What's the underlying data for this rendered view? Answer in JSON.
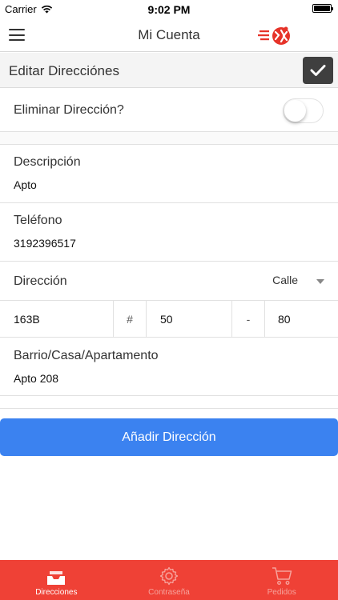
{
  "status_bar": {
    "carrier": "Carrier",
    "time": "9:02 PM"
  },
  "nav": {
    "title": "Mi Cuenta",
    "menu_icon": "hamburger-menu-icon",
    "logo": "brand-logo"
  },
  "section": {
    "title": "Editar Direcciónes",
    "confirm_icon": "checkmark-icon"
  },
  "form": {
    "delete_label": "Eliminar Dirección?",
    "delete_toggle_on": false,
    "description_label": "Descripción",
    "description_value": "Apto",
    "phone_label": "Teléfono",
    "phone_value": "3192396517",
    "address_label": "Dirección",
    "street_type": "Calle",
    "address_parts": {
      "number1": "163B",
      "hash": "#",
      "number2": "50",
      "dash": "-",
      "number3": "80"
    },
    "neighborhood_label": "Barrio/Casa/Apartamento",
    "neighborhood_value": "Apto 208"
  },
  "actions": {
    "add_address": "Añadir Dirección"
  },
  "tabs": [
    {
      "label": "Direcciones",
      "icon": "inbox-icon",
      "active": true
    },
    {
      "label": "Contraseña",
      "icon": "gear-icon",
      "active": false
    },
    {
      "label": "Pedidos",
      "icon": "cart-icon",
      "active": false
    }
  ],
  "colors": {
    "accent_blue": "#3b82f0",
    "tab_bar_red": "#ef4136",
    "confirm_dark": "#3f3f3f"
  }
}
